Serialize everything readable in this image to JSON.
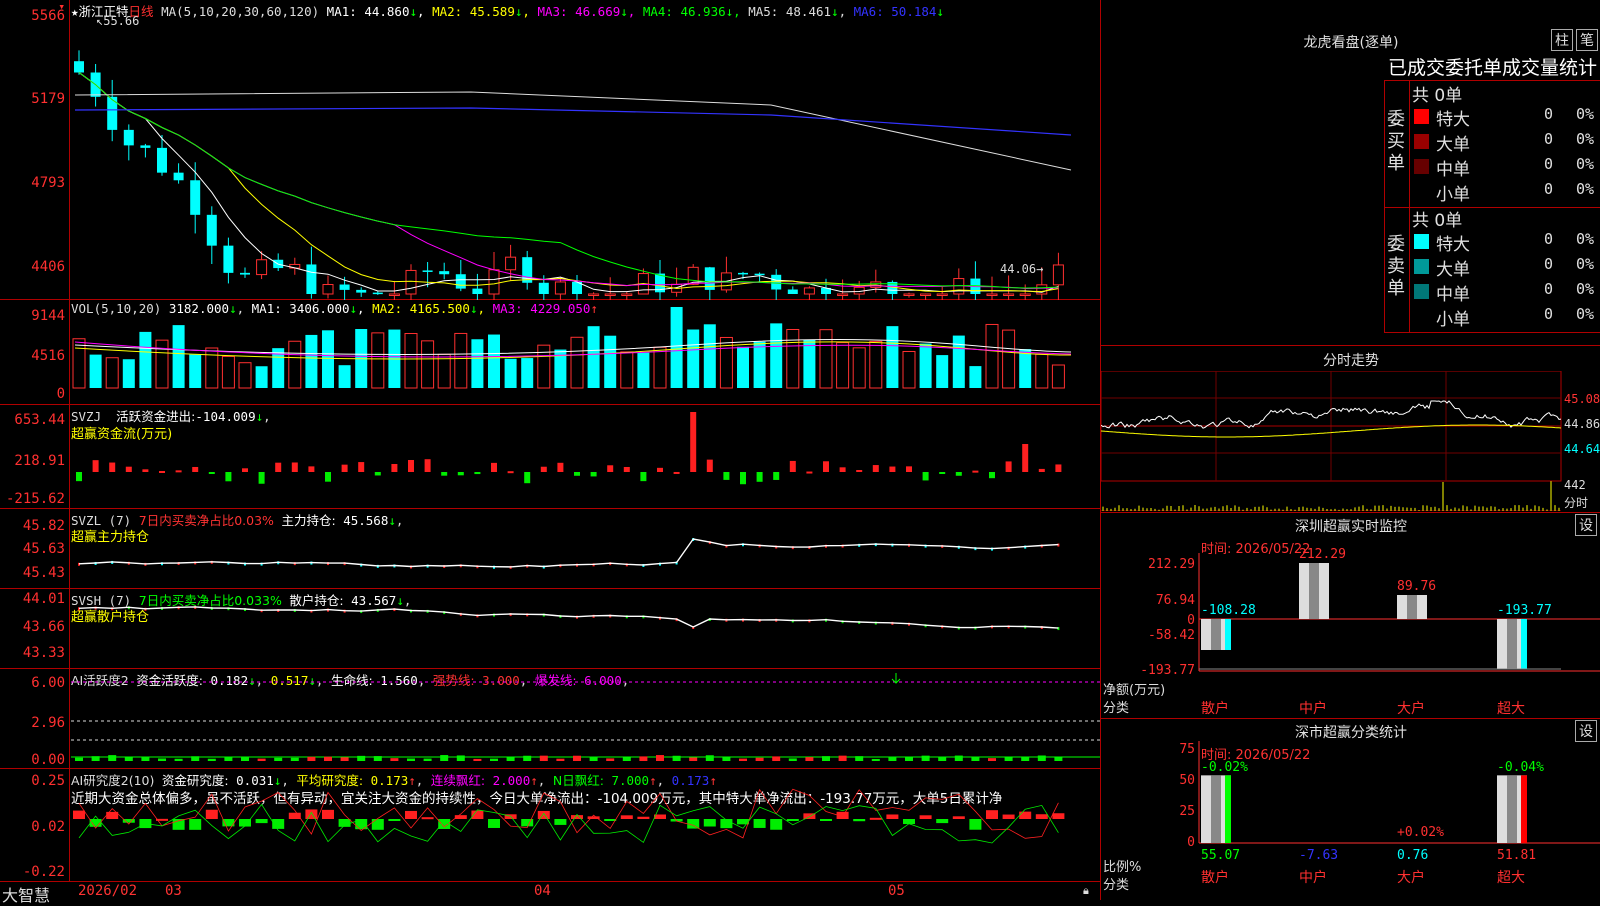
{
  "stock": {
    "star": "★",
    "name": "浙江正特",
    "period": "日线"
  },
  "ma": {
    "label": "MA(5,10,20,30,60,120)",
    "items": [
      {
        "name": "MA1:",
        "value": "44.860",
        "arrow": "↓",
        "color": "#ffffff"
      },
      {
        "name": "MA2:",
        "value": "45.589",
        "arrow": "↓",
        "color": "#ffff00"
      },
      {
        "name": "MA3:",
        "value": "46.669",
        "arrow": "↓",
        "color": "#ff00ff"
      },
      {
        "name": "MA4:",
        "value": "46.936",
        "arrow": "↓",
        "color": "#00ff00"
      },
      {
        "name": "MA5:",
        "value": "48.461",
        "arrow": "↓",
        "color": "#dddddd"
      },
      {
        "name": "MA6:",
        "value": "50.184",
        "arrow": "↓",
        "color": "#0000ff"
      }
    ],
    "high_label": "55.66",
    "low_label": "44.06"
  },
  "price_axis": [
    "5566",
    "5179",
    "4793",
    "4406"
  ],
  "vol": {
    "label": "VOL(5,10,20)",
    "value": "3182.000",
    "arrow": "↓",
    "items": [
      {
        "name": "MA1:",
        "value": "3406.000",
        "arrow": "↓",
        "color": "#ffffff"
      },
      {
        "name": "MA2:",
        "value": "4165.500",
        "arrow": "↓",
        "color": "#ffff00"
      },
      {
        "name": "MA3:",
        "value": "4229.050",
        "arrow": "↑",
        "color": "#ff00ff"
      }
    ],
    "axis": [
      "9144",
      "4516",
      "0"
    ]
  },
  "svzj": {
    "label": "SVZJ",
    "text": "活跃资金进出:",
    "value": "-104.009",
    "arrow": "↓",
    "suffix": ",",
    "sub": "超赢资金流(万元)",
    "axis": [
      "653.44",
      "218.91",
      "-215.62"
    ]
  },
  "svzl": {
    "label": "SVZL (7)",
    "pct_text": "7日内买卖净占比0.03%",
    "text": "主力持仓:",
    "value": "45.568",
    "arrow": "↓",
    "suffix": ",",
    "sub": "超赢主力持仓",
    "axis": [
      "45.82",
      "45.63",
      "45.43"
    ]
  },
  "svsh": {
    "label": "SVSH (7)",
    "pct_text": "7日内买卖净占比0.033%",
    "text": "散户持仓:",
    "value": "43.567",
    "arrow": "↓",
    "suffix": ",",
    "sub": "超赢散户持仓",
    "axis": [
      "44.01",
      "43.66",
      "43.33"
    ]
  },
  "ai1": {
    "label": "AI活跃度2",
    "t1": "资金活跃度:",
    "v1": "0.182",
    "a1": "↓",
    "v2": "0.517",
    "a2": "↓",
    "t3": "生命线:",
    "v3": "1.560",
    "t4": "强势线:",
    "v4": "3.000",
    "t5": "爆发线:",
    "v5": "6.000",
    "axis": [
      "6.00",
      "2.96",
      "0.00"
    ]
  },
  "ai2": {
    "label": "AI研究度2(10)",
    "t1": "资金研究度:",
    "v1": "0.031",
    "a1": "↓",
    "t2": "平均研究度:",
    "v2": "0.173",
    "a2": "↑",
    "t3": "连续飘红:",
    "v3": "2.000",
    "a3": "↑",
    "t4": "N日飘红:",
    "v4": "7.000",
    "a4": "↑",
    "v5": "0.173",
    "a5": "↑",
    "comment": "近期大资金总体偏多，虽不活跃，但有异动，宜关注大资金的持续性，今日大单净流出：-104.009万元，其中特大单净流出：-193.77万元，大单5日累计净",
    "axis": [
      "0.25",
      "0.02",
      "-0.22"
    ]
  },
  "bottom": {
    "brand": "大智慧",
    "dates": [
      "2026/02",
      "03",
      "04",
      "05"
    ]
  },
  "longhu": {
    "title": "龙虎看盘(逐单)",
    "btn1": "柱",
    "btn2": "笔",
    "subtitle": "已成交委托单成交量统计",
    "buy": {
      "side": "委买单",
      "total": "共 0单",
      "rows": [
        {
          "label": "特大",
          "count": "0",
          "pct": "0%",
          "color": "#ff0000"
        },
        {
          "label": "大单",
          "count": "0",
          "pct": "0%",
          "color": "#990000"
        },
        {
          "label": "中单",
          "count": "0",
          "pct": "0%",
          "color": "#660000"
        },
        {
          "label": "小单",
          "count": "0",
          "pct": "0%",
          "color": "#000000"
        }
      ]
    },
    "sell": {
      "side": "委卖单",
      "total": "共 0单",
      "rows": [
        {
          "label": "特大",
          "count": "0",
          "pct": "0%",
          "color": "#00ffff"
        },
        {
          "label": "大单",
          "count": "0",
          "pct": "0%",
          "color": "#009999"
        },
        {
          "label": "中单",
          "count": "0",
          "pct": "0%",
          "color": "#007777"
        },
        {
          "label": "小单",
          "count": "0",
          "pct": "0%",
          "color": "#000000"
        }
      ]
    }
  },
  "intraday": {
    "title": "分时走势",
    "p1": "45.08",
    "p2": "44.86",
    "p3": "44.64",
    "vol": "442",
    "vol_unit": "分时"
  },
  "monitor": {
    "title": "深圳超赢实时监控",
    "btn": "设",
    "time": "时间: 2026/05/22",
    "axis": [
      "212.29",
      "76.94",
      "0",
      "-58.42",
      "-193.77"
    ],
    "ylabel": "净额(万元)",
    "xlabel": "分类",
    "cats": [
      "散户",
      "中户",
      "大户",
      "超大"
    ],
    "values": [
      "-108.28",
      "212.29",
      "89.76",
      "-193.77"
    ]
  },
  "classify": {
    "title": "深市超赢分类统计",
    "btn": "设",
    "time": "时间: 2026/05/22",
    "axis": [
      "75",
      "50",
      "25",
      "0"
    ],
    "ylabel": "比例%",
    "xlabel": "分类",
    "cats": [
      "散户",
      "中户",
      "大户",
      "超大"
    ],
    "top": [
      "-0.02%",
      "",
      "+0.02%",
      "-0.04%"
    ],
    "bottom": [
      "55.07",
      "-7.63",
      "0.76",
      "51.81"
    ]
  }
}
